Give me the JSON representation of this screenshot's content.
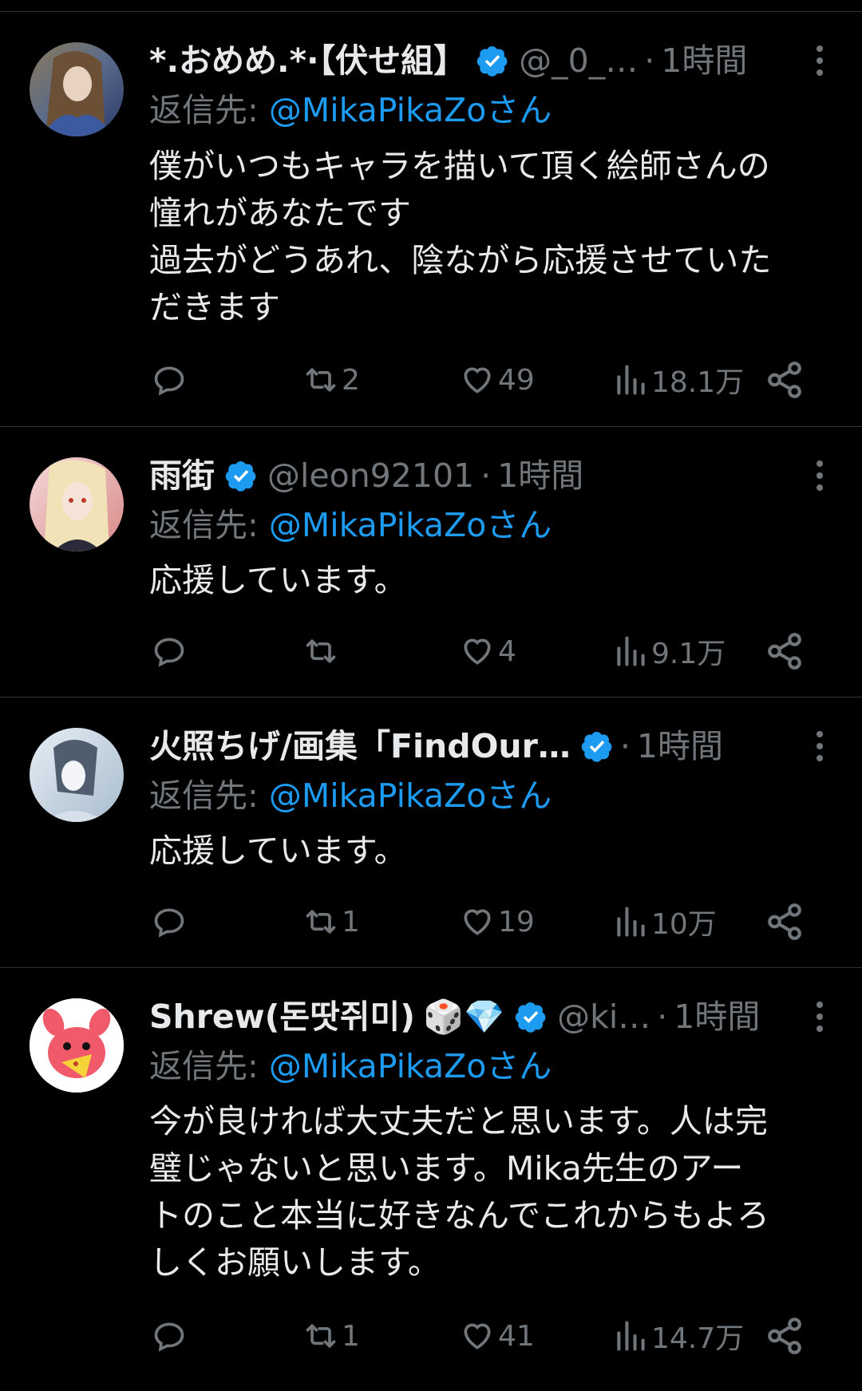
{
  "replies": [
    {
      "name": "*.おめめ.*·【伏せ組】",
      "handle": "@_0_…",
      "time": "1時間",
      "reply_prefix": "返信先: ",
      "reply_to": "@MikaPikaZoさん",
      "text": "僕がいつもキャラを描いて頂く絵師さんの\n憧れがあなたです\n過去がどうあれ、陰ながら応援させていた\nだきます",
      "retweets": "2",
      "likes": "49",
      "views": "18.1万"
    },
    {
      "name": "雨街",
      "handle": "@leon92101",
      "time": "1時間",
      "reply_prefix": "返信先: ",
      "reply_to": "@MikaPikaZoさん",
      "text": "応援しています。",
      "retweets": "",
      "likes": "4",
      "views": "9.1万"
    },
    {
      "name": "火照ちげ/画集「FindOur…",
      "handle": "",
      "time": "1時間",
      "reply_prefix": "返信先: ",
      "reply_to": "@MikaPikaZoさん",
      "text": "応援しています。",
      "retweets": "1",
      "likes": "19",
      "views": "10万"
    },
    {
      "name": "Shrew(돈땃쥐미)",
      "emoji": "🎲💎",
      "handle": "@ki…",
      "time": "1時間",
      "reply_prefix": "返信先: ",
      "reply_to": "@MikaPikaZoさん",
      "text": "今が良ければ大丈夫だと思います。人は完\n璧じゃないと思います。Mika先生のアー\nトのこと本当に好きなんでこれからもよろ\nしくお願いします。",
      "retweets": "1",
      "likes": "41",
      "views": "14.7万"
    }
  ],
  "icons": {
    "verified": "verified-badge-icon",
    "more": "more-vertical-icon",
    "reply": "reply-icon",
    "retweet": "retweet-icon",
    "like": "heart-icon",
    "views": "views-chart-icon",
    "share": "share-icon"
  },
  "colors": {
    "background": "#000000",
    "text": "#e7e9ea",
    "secondary": "#71767b",
    "link": "#1d9bf0",
    "divider": "#2f3336"
  }
}
